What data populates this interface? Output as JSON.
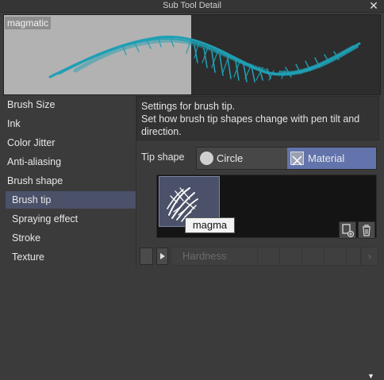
{
  "window": {
    "title": "Sub Tool Detail"
  },
  "preview": {
    "label": "magmatic",
    "stroke_color": "#1fa3b8"
  },
  "sidebar": {
    "categories": [
      "Brush Size",
      "Ink",
      "Color Jitter",
      "Anti-aliasing",
      "Brush shape"
    ],
    "subitems": [
      "Brush tip",
      "Spraying effect",
      "Stroke",
      "Texture"
    ],
    "selected": "Brush tip"
  },
  "description": {
    "line1": "Settings for brush tip.",
    "line2": "Set how brush tip shapes change with pen tilt and",
    "line3": "direction."
  },
  "tip_shape": {
    "label": "Tip shape",
    "options": [
      "Circle",
      "Material"
    ],
    "selected": "Material"
  },
  "tip_panel": {
    "tooltip": "magma"
  },
  "hardness": {
    "label": "Hardness"
  },
  "colors": {
    "accent": "#6374ac",
    "selected_row": "#4a5168"
  }
}
